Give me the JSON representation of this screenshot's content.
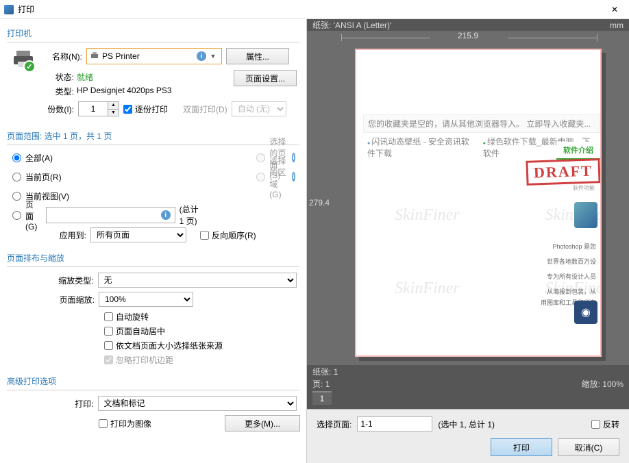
{
  "window": {
    "title": "打印",
    "close": "✕"
  },
  "printer_section": {
    "title": "打印机",
    "name_label": "名称(N):",
    "selected_printer": "PS Printer",
    "props_btn": "属性...",
    "page_setup_btn": "页面设置...",
    "status_label": "状态:",
    "status_value": "就绪",
    "type_label": "类型:",
    "type_value": "HP Designjet 4020ps PS3",
    "copies_label": "份数(I):",
    "copies_value": "1",
    "collate_label": "逐份打印",
    "duplex_label": "双面打印(D)",
    "duplex_value": "自动 (无)"
  },
  "range_section": {
    "title_prefix": "页面范围:",
    "title_info": "选中 1 页，共 1 页",
    "all": "全部(A)",
    "current": "当前页(R)",
    "current_view": "当前视图(V)",
    "pages": "页面(G)",
    "selected_pages": "选择的页面(S)",
    "selected_area": "选择的区域(G)",
    "total_text": "(总计 1 页)",
    "apply_to_label": "应用到:",
    "apply_to_value": "所有页面",
    "reverse_label": "反向顺序(R)"
  },
  "scale_section": {
    "title": "页面排布与缩放",
    "type_label": "缩放类型:",
    "type_value": "无",
    "zoom_label": "页面缩放:",
    "zoom_value": "100%",
    "auto_rotate": "自动旋转",
    "auto_center": "页面自动居中",
    "choose_paper": "依文档页面大小选择纸张来源",
    "ignore_margin": "忽略打印机边距"
  },
  "advanced_section": {
    "title": "高级打印选项",
    "print_label": "打印:",
    "print_value": "文档和标记",
    "as_image": "打印为图像",
    "more_btn": "更多(M)..."
  },
  "preview": {
    "paper_label": "纸张:",
    "paper_value": "'ANSI A (Letter)'",
    "unit": "mm",
    "width": "215.9",
    "height": "279.4",
    "sheets_label": "纸张:",
    "sheets_value": "1",
    "page_label": "页:",
    "page_value": "1",
    "zoom_label": "缩放:",
    "zoom_value": "100%",
    "page_tab": "1",
    "watermark": "SkinFiner",
    "content_line1": "您的收藏夹是空的，请从其他浏览器导入。 立即导入收藏夹...",
    "content_line2a": "闪讯动态壁纸 - 安全资讯软件下载",
    "content_line2b": "绿色软件下载_最新电脑软件",
    "content_line2c": "下载",
    "tab_text": "软件介绍",
    "draft": "DRAFT",
    "sub_text": "软件功能",
    "t1": "Photoshop 是您",
    "t2": "世界各地数百万设",
    "t3": "专为所有设计人员",
    "t4": "从海报到包装，从",
    "t5": "用图库和工具和所有"
  },
  "bottom": {
    "select_label": "选择页面:",
    "select_value": "1-1",
    "select_info": "(选中 1, 总计 1)",
    "invert": "反转",
    "print_btn": "打印",
    "cancel_btn": "取消(C)"
  }
}
